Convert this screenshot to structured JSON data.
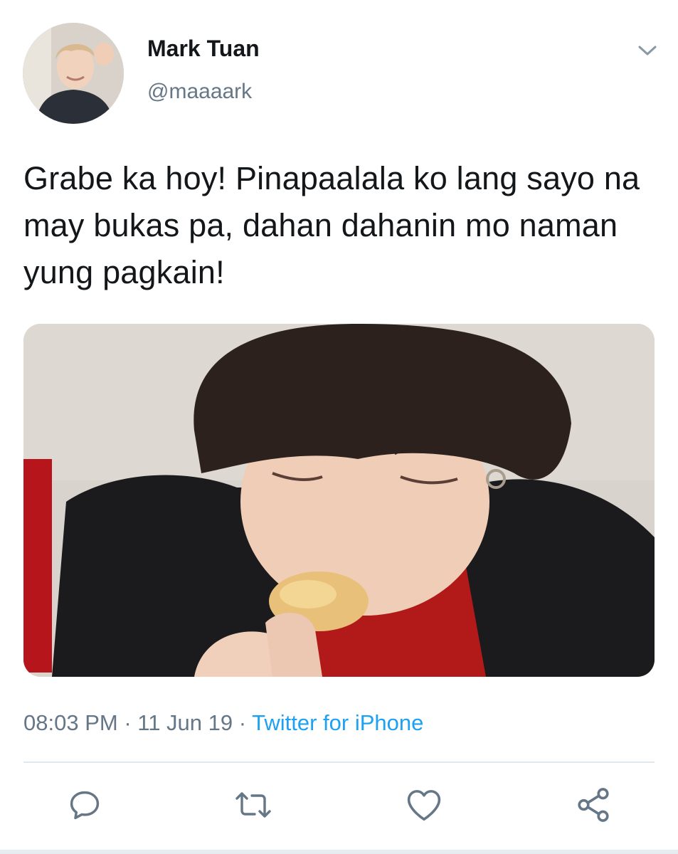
{
  "user": {
    "display_name": "Mark Tuan",
    "handle": "@maaaark"
  },
  "tweet": {
    "text": "Grabe ka hoy! Pinapaalala ko lang sayo na may bukas pa, dahan dahanin mo naman yung pagkain!",
    "time": "08:03 PM",
    "date": "11 Jun 19",
    "separator": " · ",
    "source": "Twitter for iPhone"
  },
  "icons": {
    "caret": "chevron-down-icon",
    "reply": "reply-icon",
    "retweet": "retweet-icon",
    "like": "heart-icon",
    "share": "share-icon"
  },
  "colors": {
    "text": "#14171a",
    "secondary": "#657786",
    "link": "#1da1f2",
    "divider": "#e1e8ed"
  }
}
